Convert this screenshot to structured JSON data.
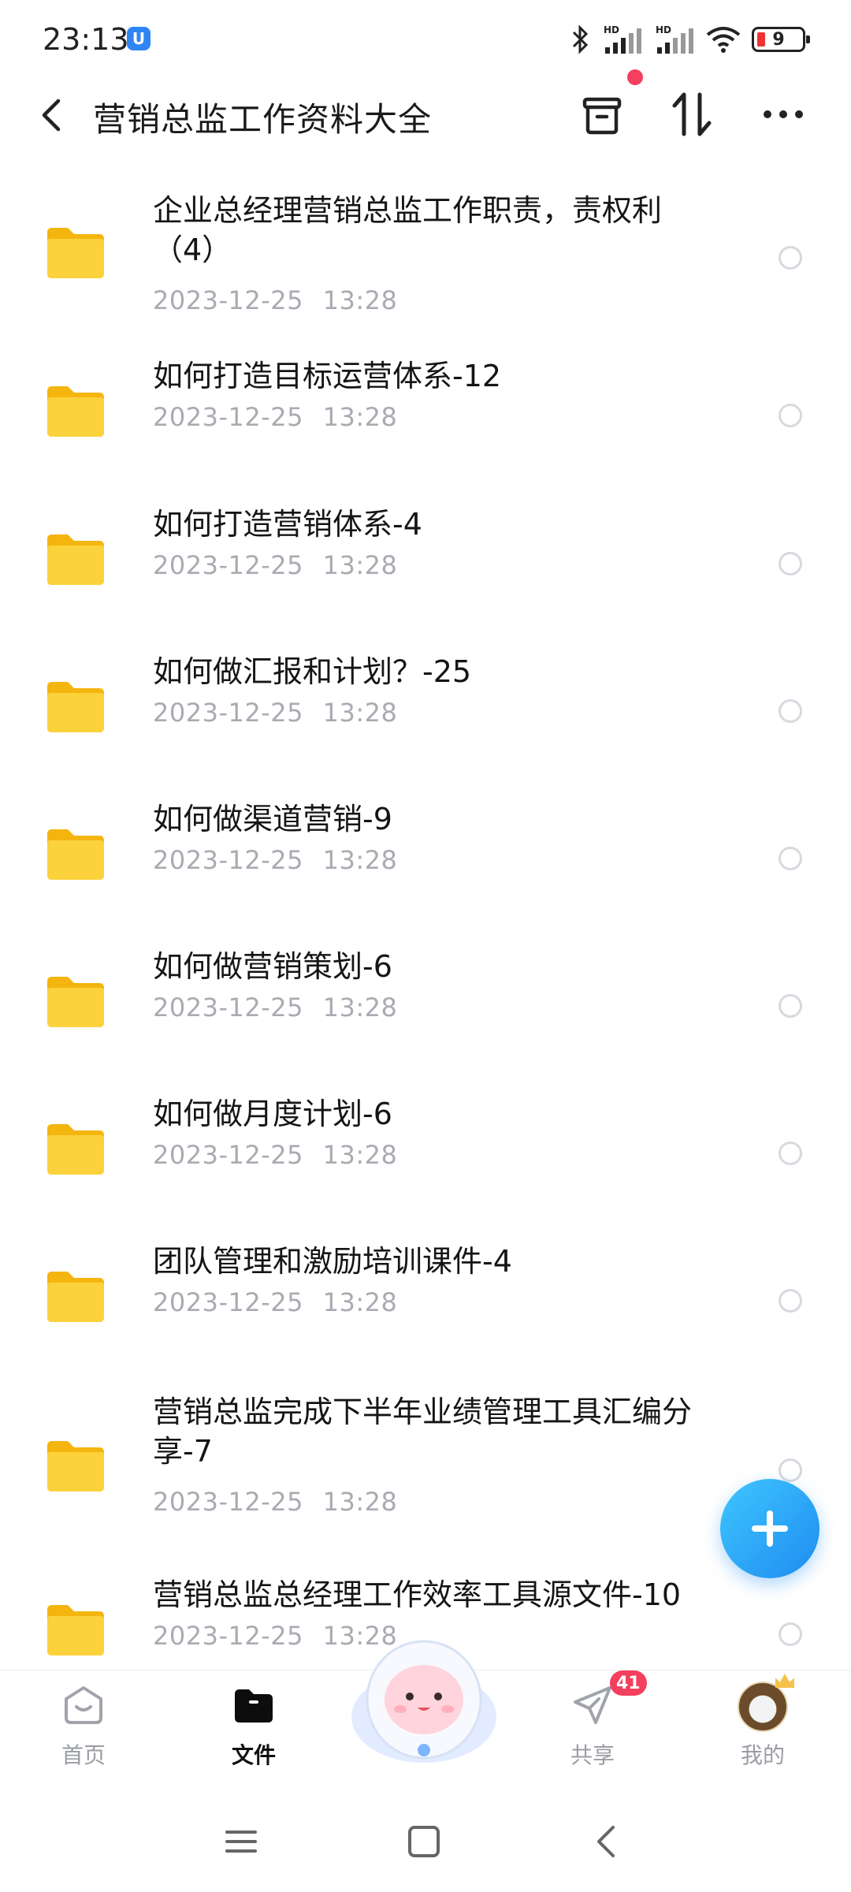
{
  "status_bar": {
    "time": "23:13",
    "app_badge": "U",
    "battery": "9",
    "signal_label": "HD"
  },
  "header": {
    "title": "营销总监工作资料大全",
    "notification_dot_color": "#f43f5e"
  },
  "files": [
    {
      "name": "企业总经理营销总监工作职责，责权利\n（4）",
      "time": "2023-12-25  13:28"
    },
    {
      "name": "如何打造目标运营体系-12",
      "time": "2023-12-25  13:28"
    },
    {
      "name": "如何打造营销体系-4",
      "time": "2023-12-25  13:28"
    },
    {
      "name": "如何做汇报和计划？-25",
      "time": "2023-12-25  13:28"
    },
    {
      "name": "如何做渠道营销-9",
      "time": "2023-12-25  13:28"
    },
    {
      "name": "如何做营销策划-6",
      "time": "2023-12-25  13:28"
    },
    {
      "name": "如何做月度计划-6",
      "time": "2023-12-25  13:28"
    },
    {
      "name": "团队管理和激励培训课件-4",
      "time": "2023-12-25  13:28"
    },
    {
      "name": "营销总监完成下半年业绩管理工具汇编分\n享-7",
      "time": "2023-12-25  13:28"
    },
    {
      "name": "营销总监总经理工作效率工具源文件-10",
      "time": "2023-12-25  13:28"
    }
  ],
  "bottom_nav": {
    "home": "首页",
    "files": "文件",
    "share": "共享",
    "share_badge": "41",
    "mine": "我的"
  },
  "colors": {
    "accent": "#1e8cf0",
    "folder": "#fcc934",
    "badge": "#f43f5e"
  }
}
